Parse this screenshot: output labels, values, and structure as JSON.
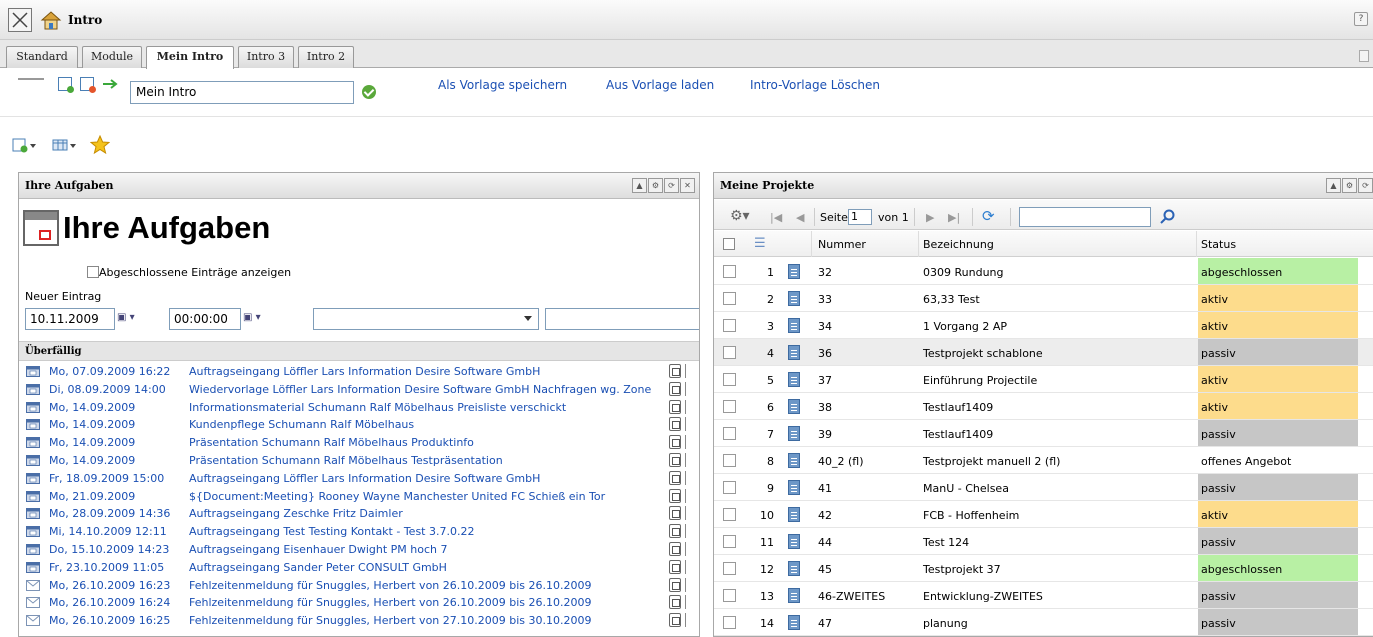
{
  "window": {
    "title": "Intro",
    "help": "?"
  },
  "tabs": [
    {
      "label": "Standard",
      "active": false
    },
    {
      "label": "Module",
      "active": false
    },
    {
      "label": "Mein Intro",
      "active": true
    },
    {
      "label": "Intro 3",
      "active": false
    },
    {
      "label": "Intro 2",
      "active": false
    }
  ],
  "intro_editor": {
    "name_value": "Mein Intro",
    "links": [
      "Als Vorlage speichern",
      "Aus Vorlage laden",
      "Intro-Vorlage Löschen"
    ]
  },
  "aufgaben": {
    "panel_title": "Ihre Aufgaben",
    "big_title": "Ihre Aufgaben",
    "show_completed_label": "Abgeschlossene Einträge anzeigen",
    "new_entry_label": "Neuer Eintrag",
    "date_value": "10.11.2009",
    "time_value": "00:00:00",
    "section_overdue": "Überfällig",
    "tasks": [
      {
        "date": "Mo, 07.09.2009 16:22",
        "text": "Auftragseingang Löffler Lars Information Desire Software GmbH",
        "icon": "calendar-icon"
      },
      {
        "date": "Di, 08.09.2009 14:00",
        "text": "Wiedervorlage Löffler Lars Information Desire Software GmbH Nachfragen wg. Zone",
        "icon": "calendar-icon"
      },
      {
        "date": "Mo, 14.09.2009",
        "text": "Informationsmaterial Schumann Ralf Möbelhaus Preisliste verschickt",
        "icon": "calendar-icon"
      },
      {
        "date": "Mo, 14.09.2009",
        "text": "Kundenpflege Schumann Ralf Möbelhaus",
        "icon": "calendar-icon"
      },
      {
        "date": "Mo, 14.09.2009",
        "text": "Präsentation Schumann Ralf Möbelhaus Produktinfo",
        "icon": "calendar-icon"
      },
      {
        "date": "Mo, 14.09.2009",
        "text": "Präsentation Schumann Ralf Möbelhaus Testpräsentation",
        "icon": "calendar-icon"
      },
      {
        "date": "Fr, 18.09.2009 15:00",
        "text": "Auftragseingang Löffler Lars Information Desire Software GmbH",
        "icon": "calendar-icon"
      },
      {
        "date": "Mo, 21.09.2009",
        "text": "${Document:Meeting} Rooney Wayne Manchester United FC Schieß ein Tor",
        "icon": "calendar-icon"
      },
      {
        "date": "Mo, 28.09.2009 14:36",
        "text": "Auftragseingang Zeschke Fritz Daimler",
        "icon": "calendar-icon"
      },
      {
        "date": "Mi, 14.10.2009 12:11",
        "text": "Auftragseingang Test Testing Kontakt - Test 3.7.0.22",
        "icon": "calendar-icon"
      },
      {
        "date": "Do, 15.10.2009 14:23",
        "text": "Auftragseingang Eisenhauer Dwight PM hoch 7",
        "icon": "calendar-icon"
      },
      {
        "date": "Fr, 23.10.2009 11:05",
        "text": "Auftragseingang Sander Peter CONSULT GmbH",
        "icon": "calendar-icon"
      },
      {
        "date": "Mo, 26.10.2009 16:23",
        "text": "Fehlzeitenmeldung für Snuggles, Herbert von 26.10.2009 bis 26.10.2009",
        "icon": "mail-icon"
      },
      {
        "date": "Mo, 26.10.2009 16:24",
        "text": "Fehlzeitenmeldung für Snuggles, Herbert von 26.10.2009 bis 26.10.2009",
        "icon": "mail-icon"
      },
      {
        "date": "Mo, 26.10.2009 16:25",
        "text": "Fehlzeitenmeldung für Snuggles, Herbert von 27.10.2009 bis 30.10.2009",
        "icon": "mail-icon"
      }
    ]
  },
  "projekte": {
    "panel_title": "Meine Projekte",
    "pager": {
      "page_label": "Seite",
      "page_value": "1",
      "of_label": "von 1"
    },
    "columns": {
      "nummer": "Nummer",
      "bezeichnung": "Bezeichnung",
      "status": "Status"
    },
    "status_colors": {
      "abgeschlossen": "#b8f0a4",
      "aktiv": "#fddc8c",
      "passiv": "#c6c6c6",
      "offenes Angebot": "#ffffff"
    },
    "rows": [
      {
        "n": "1",
        "nummer": "32",
        "bezeichnung": "0309 Rundung",
        "status": "abgeschlossen"
      },
      {
        "n": "2",
        "nummer": "33",
        "bezeichnung": "63,33 Test",
        "status": "aktiv"
      },
      {
        "n": "3",
        "nummer": "34",
        "bezeichnung": "1 Vorgang 2 AP",
        "status": "aktiv"
      },
      {
        "n": "4",
        "nummer": "36",
        "bezeichnung": "Testprojekt schablone",
        "status": "passiv"
      },
      {
        "n": "5",
        "nummer": "37",
        "bezeichnung": "Einführung Projectile",
        "status": "aktiv"
      },
      {
        "n": "6",
        "nummer": "38",
        "bezeichnung": "Testlauf1409",
        "status": "aktiv"
      },
      {
        "n": "7",
        "nummer": "39",
        "bezeichnung": "Testlauf1409",
        "status": "passiv"
      },
      {
        "n": "8",
        "nummer": "40_2 (fl)",
        "bezeichnung": "Testprojekt manuell 2 (fl)",
        "status": "offenes Angebot"
      },
      {
        "n": "9",
        "nummer": "41",
        "bezeichnung": "ManU - Chelsea",
        "status": "passiv"
      },
      {
        "n": "10",
        "nummer": "42",
        "bezeichnung": "FCB - Hoffenheim",
        "status": "aktiv"
      },
      {
        "n": "11",
        "nummer": "44",
        "bezeichnung": "Test 124",
        "status": "passiv"
      },
      {
        "n": "12",
        "nummer": "45",
        "bezeichnung": "Testprojekt 37",
        "status": "abgeschlossen"
      },
      {
        "n": "13",
        "nummer": "46-ZWEITES",
        "bezeichnung": "Entwicklung-ZWEITES",
        "status": "passiv"
      },
      {
        "n": "14",
        "nummer": "47",
        "bezeichnung": "planung",
        "status": "passiv"
      }
    ]
  }
}
